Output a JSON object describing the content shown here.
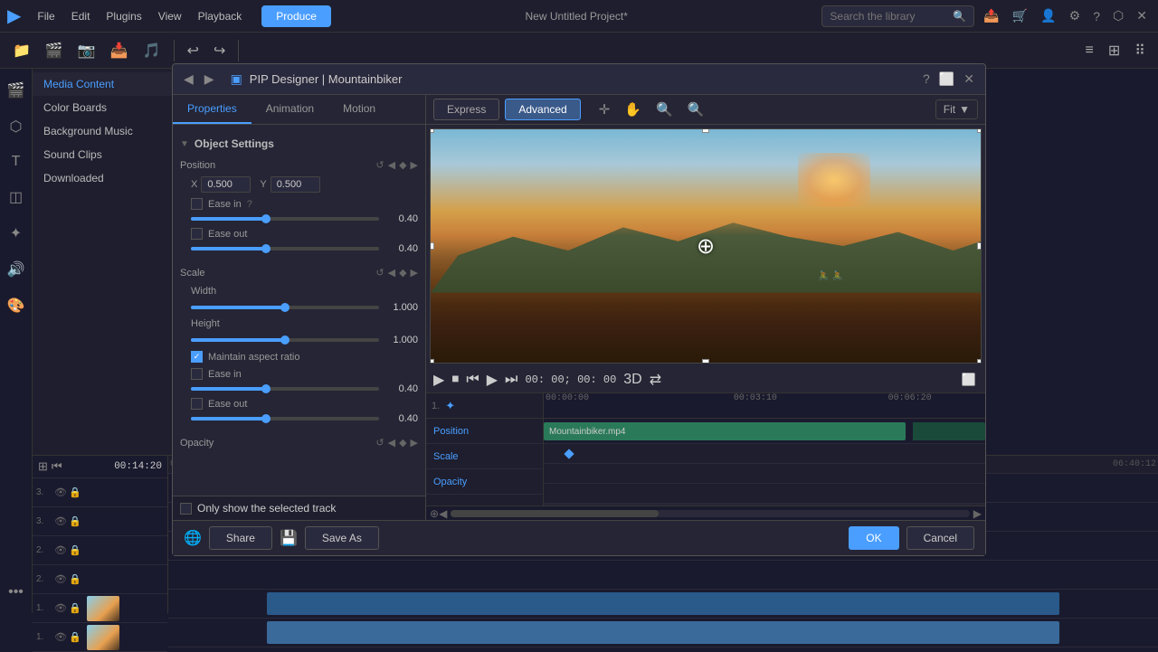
{
  "app": {
    "title": "New Untitled Project*"
  },
  "topbar": {
    "menus": [
      "File",
      "Edit",
      "Plugins",
      "View",
      "Playback"
    ],
    "produce_label": "Produce",
    "search_placeholder": "Search the library",
    "icons_right": [
      "export",
      "cart",
      "user",
      "settings",
      "help",
      "resize",
      "close"
    ]
  },
  "left_panel": {
    "items": [
      {
        "label": "Media Content",
        "active": true
      },
      {
        "label": "Color Boards"
      },
      {
        "label": "Background Music",
        "active_text": true
      },
      {
        "label": "Sound Clips"
      },
      {
        "label": "Downloaded"
      }
    ]
  },
  "pip": {
    "title": "PIP Designer | Mountainbiker",
    "tabs": [
      "Properties",
      "Animation",
      "Motion"
    ],
    "active_tab": "Properties",
    "express_label": "Express",
    "advanced_label": "Advanced",
    "fit_label": "Fit",
    "object_settings": {
      "section": "Object Settings",
      "position": {
        "label": "Position",
        "x": "0.500",
        "y": "0.500",
        "ease_in": {
          "label": "Ease in",
          "checked": false,
          "value": "0.40"
        },
        "ease_out": {
          "label": "Ease out",
          "checked": false,
          "value": "0.40"
        }
      },
      "scale": {
        "label": "Scale",
        "width": {
          "label": "Width",
          "value": "1.000",
          "percent": 50
        },
        "height": {
          "label": "Height",
          "value": "1.000",
          "percent": 50
        },
        "maintain_aspect": {
          "label": "Maintain aspect ratio",
          "checked": true
        },
        "ease_in": {
          "label": "Ease in",
          "checked": false,
          "value": "0.40"
        },
        "ease_out": {
          "label": "Ease out",
          "checked": false,
          "value": "0.40"
        }
      },
      "opacity": {
        "label": "Opacity"
      }
    },
    "only_show": "Only show the selected track",
    "timecode": "00: 00; 00: 00",
    "mode_3d": "3D",
    "timeline": {
      "markers": [
        "00:00:00",
        "00:03:10",
        "00:06:20"
      ],
      "clip_label": "Mountainbiker.mp4",
      "tracks": [
        "Position",
        "Scale",
        "Opacity"
      ]
    },
    "footer": {
      "share_label": "Share",
      "save_as_label": "Save As",
      "ok_label": "OK",
      "cancel_label": "Cancel"
    }
  },
  "bottom_timeline": {
    "timecode": "00:14:20",
    "end_timecode": "06:40:12",
    "tracks": [
      {
        "num": "3.",
        "type": "video"
      },
      {
        "num": "3.",
        "type": "video"
      },
      {
        "num": "2.",
        "type": "video"
      },
      {
        "num": "2.",
        "type": "video"
      },
      {
        "num": "1.",
        "type": "video",
        "has_thumb": true
      },
      {
        "num": "1.",
        "type": "video",
        "has_thumb": true
      }
    ]
  }
}
